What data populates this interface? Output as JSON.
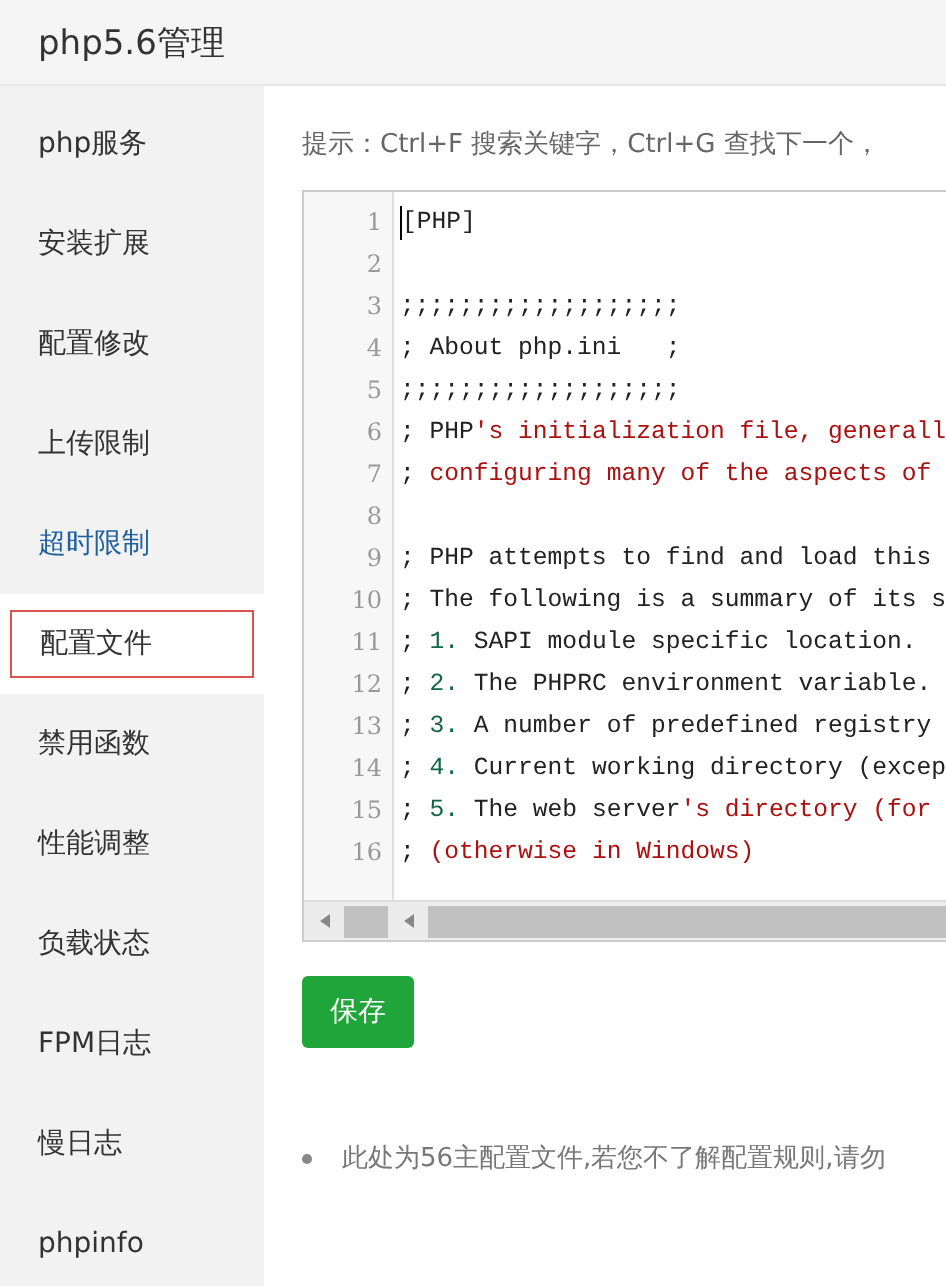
{
  "header": {
    "title": "php5.6管理"
  },
  "sidebar": {
    "items": [
      {
        "label": "php服务",
        "selected": false,
        "hovered": false
      },
      {
        "label": "安装扩展",
        "selected": false,
        "hovered": false
      },
      {
        "label": "配置修改",
        "selected": false,
        "hovered": false
      },
      {
        "label": "上传限制",
        "selected": false,
        "hovered": false
      },
      {
        "label": "超时限制",
        "selected": false,
        "hovered": true
      },
      {
        "label": "配置文件",
        "selected": true,
        "hovered": false
      },
      {
        "label": "禁用函数",
        "selected": false,
        "hovered": false
      },
      {
        "label": "性能调整",
        "selected": false,
        "hovered": false
      },
      {
        "label": "负载状态",
        "selected": false,
        "hovered": false
      },
      {
        "label": "FPM日志",
        "selected": false,
        "hovered": false
      },
      {
        "label": "慢日志",
        "selected": false,
        "hovered": false
      },
      {
        "label": "phpinfo",
        "selected": false,
        "hovered": false
      }
    ]
  },
  "hint": "提示：Ctrl+F 搜索关键字，Ctrl+G 查找下一个，",
  "editor": {
    "lines": [
      {
        "number": "1",
        "segments": [
          {
            "kind": "text",
            "text": "[PHP]"
          }
        ]
      },
      {
        "number": "2"
      },
      {
        "number": "3",
        "segments": [
          {
            "kind": "text",
            "text": ";;;;;;;;;;;;;;;;;;;"
          }
        ]
      },
      {
        "number": "4",
        "segments": [
          {
            "kind": "text",
            "text": "; About php.ini   ;"
          }
        ]
      },
      {
        "number": "5",
        "segments": [
          {
            "kind": "text",
            "text": ";;;;;;;;;;;;;;;;;;;"
          }
        ]
      },
      {
        "number": "6",
        "segments": [
          {
            "kind": "text",
            "text": "; PHP"
          },
          {
            "kind": "string",
            "text": "'s initialization file, generall"
          }
        ]
      },
      {
        "number": "7",
        "segments": [
          {
            "kind": "text",
            "text": "; "
          },
          {
            "kind": "string",
            "text": "configuring many of the aspects of"
          }
        ]
      },
      {
        "number": "8"
      },
      {
        "number": "9",
        "segments": [
          {
            "kind": "text",
            "text": "; PHP attempts to find and load this"
          }
        ]
      },
      {
        "number": "10",
        "segments": [
          {
            "kind": "text",
            "text": "; The following is a summary of its s"
          }
        ]
      },
      {
        "number": "11",
        "segments": [
          {
            "kind": "text",
            "text": "; "
          },
          {
            "kind": "number",
            "text": "1."
          },
          {
            "kind": "text",
            "text": " SAPI module specific location."
          }
        ]
      },
      {
        "number": "12",
        "segments": [
          {
            "kind": "text",
            "text": "; "
          },
          {
            "kind": "number",
            "text": "2."
          },
          {
            "kind": "text",
            "text": " The PHPRC environment variable."
          }
        ]
      },
      {
        "number": "13",
        "segments": [
          {
            "kind": "text",
            "text": "; "
          },
          {
            "kind": "number",
            "text": "3."
          },
          {
            "kind": "text",
            "text": " A number of predefined registry"
          }
        ]
      },
      {
        "number": "14",
        "segments": [
          {
            "kind": "text",
            "text": "; "
          },
          {
            "kind": "number",
            "text": "4."
          },
          {
            "kind": "text",
            "text": " Current working directory (excep"
          }
        ]
      },
      {
        "number": "15",
        "segments": [
          {
            "kind": "text",
            "text": "; "
          },
          {
            "kind": "number",
            "text": "5."
          },
          {
            "kind": "text",
            "text": " The web server"
          },
          {
            "kind": "string",
            "text": "'s directory (for"
          }
        ]
      },
      {
        "number": "16",
        "segments": [
          {
            "kind": "text",
            "text": "; "
          },
          {
            "kind": "string",
            "text": "(otherwise in Windows)"
          }
        ]
      }
    ]
  },
  "save_button": "保存",
  "notes": [
    "此处为56主配置文件,若您不了解配置规则,请勿"
  ]
}
